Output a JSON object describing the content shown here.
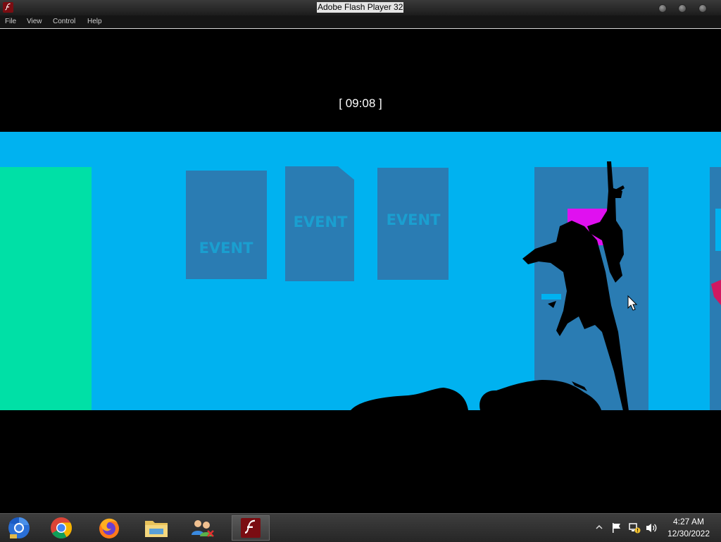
{
  "window": {
    "title": "Adobe Flash Player 32",
    "icon": "flash-player-icon",
    "controls": [
      "minimize-button",
      "maximize-button",
      "close-button"
    ]
  },
  "menu": {
    "file": "File",
    "view": "View",
    "control": "Control",
    "help": "Help"
  },
  "game": {
    "timer": "[ 09:08 ]",
    "signs": [
      "EVENT",
      "EVENT",
      "EVENT"
    ],
    "colors": {
      "background": "#00b2f0",
      "door": "#2a7cb3",
      "green_wall": "#00e0a6",
      "magenta_window": "#e010f0",
      "floor": "#000000"
    }
  },
  "taskbar": {
    "apps": [
      {
        "name": "chromium",
        "icon": "chromium-icon"
      },
      {
        "name": "chrome",
        "icon": "chrome-icon"
      },
      {
        "name": "firefox",
        "icon": "firefox-icon"
      },
      {
        "name": "file-explorer",
        "icon": "folder-icon"
      },
      {
        "name": "network-users",
        "icon": "users-icon"
      },
      {
        "name": "flash-player",
        "icon": "flash-player-icon",
        "active": true
      }
    ],
    "tray": [
      "show-hidden-icons",
      "action-center-flag-icon",
      "network-icon",
      "volume-icon"
    ],
    "time": "4:27 AM",
    "date": "12/30/2022"
  }
}
